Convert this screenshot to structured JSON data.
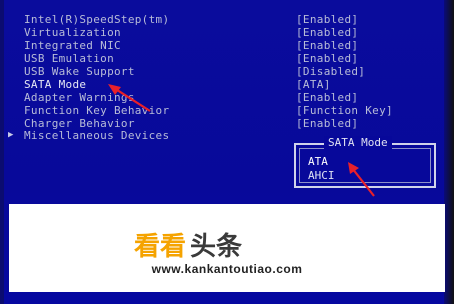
{
  "settings": [
    {
      "label": "Intel(R)SpeedStep(tm)",
      "value": "[Enabled]"
    },
    {
      "label": "Virtualization",
      "value": "[Enabled]"
    },
    {
      "label": "Integrated NIC",
      "value": "[Enabled]"
    },
    {
      "label": "USB Emulation",
      "value": "[Enabled]"
    },
    {
      "label": "USB Wake Support",
      "value": "[Disabled]"
    },
    {
      "label": "SATA Mode",
      "value": "[ATA]"
    },
    {
      "label": "Adapter Warnings",
      "value": "[Enabled]"
    },
    {
      "label": "Function Key Behavior",
      "value": "[Function Key]"
    },
    {
      "label": "Charger Behavior",
      "value": "[Enabled]"
    },
    {
      "label": "Miscellaneous Devices",
      "value": ""
    }
  ],
  "popup": {
    "title": "SATA Mode",
    "options": [
      "ATA",
      "AHCI"
    ],
    "selected": "ATA"
  },
  "watermark": {
    "brand": "看看头条",
    "url": "www.kankantoutiao.com"
  },
  "colors": {
    "background": "#08099a",
    "text": "#b8bcd8",
    "arrow": "#e8202a",
    "brand_orange": "#f5a300"
  },
  "icons": {
    "submenu": "triangle-right-icon",
    "annotation": "red-arrow-icon"
  }
}
